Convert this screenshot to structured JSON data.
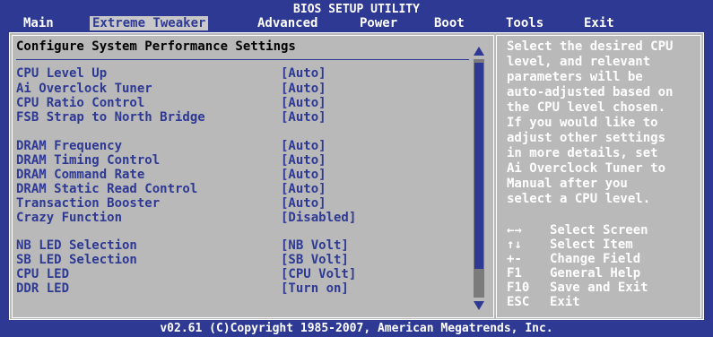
{
  "title": "BIOS SETUP UTILITY",
  "menu": [
    "Main",
    "Extreme Tweaker",
    "Advanced",
    "Power",
    "Boot",
    "Tools",
    "Exit"
  ],
  "active_menu": "Extreme Tweaker",
  "section_header": "Configure System Performance Settings",
  "options": [
    {
      "label": "CPU Level Up",
      "value": "[Auto]"
    },
    {
      "label": "Ai Overclock Tuner",
      "value": "[Auto]"
    },
    {
      "label": "CPU Ratio Control",
      "value": "[Auto]"
    },
    {
      "label": "FSB Strap to North Bridge",
      "value": "[Auto]"
    },
    {
      "label": "DRAM Frequency",
      "value": "[Auto]"
    },
    {
      "label": "DRAM Timing Control",
      "value": "[Auto]"
    },
    {
      "label": "DRAM Command Rate",
      "value": "[Auto]"
    },
    {
      "label": "DRAM Static Read Control",
      "value": "[Auto]"
    },
    {
      "label": "Transaction Booster",
      "value": "[Auto]"
    },
    {
      "label": "Crazy Function",
      "value": "[Disabled]"
    },
    {
      "label": "NB LED Selection",
      "value": "[NB Volt]"
    },
    {
      "label": "SB LED Selection",
      "value": "[SB Volt]"
    },
    {
      "label": "CPU LED",
      "value": "[CPU Volt]"
    },
    {
      "label": "DDR LED",
      "value": "[Turn on]"
    }
  ],
  "help_text": [
    "Select the desired CPU",
    "level, and relevant",
    "parameters will be",
    "auto-adjusted based on",
    "the CPU level chosen.",
    "If you would like to",
    "adjust other settings",
    "in more details, set",
    "Ai Overclock Tuner to",
    "Manual after you",
    "select a CPU level."
  ],
  "keys": [
    {
      "key": "←→",
      "desc": "Select Screen",
      "icon": "left-right-arrows-icon"
    },
    {
      "key": "↑↓",
      "desc": "Select Item",
      "icon": "up-down-arrows-icon"
    },
    {
      "key": "+-",
      "desc": "Change Field"
    },
    {
      "key": "F1",
      "desc": "General Help"
    },
    {
      "key": "F10",
      "desc": "Save and Exit"
    },
    {
      "key": "ESC",
      "desc": "Exit"
    }
  ],
  "footer": "v02.61 (C)Copyright 1985-2007, American Megatrends, Inc.",
  "colors": {
    "background": "#2e3994",
    "panel": "#b9b9b9",
    "highlight": "#c8c8c8",
    "text_white": "#ffffff"
  }
}
